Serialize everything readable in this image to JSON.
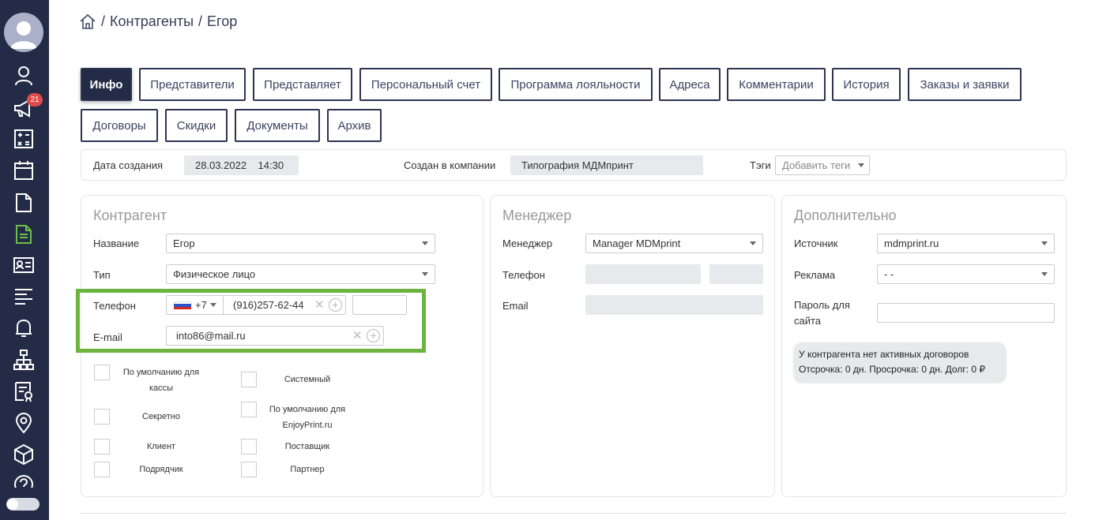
{
  "sidebar": {
    "badge_count": "21",
    "icons": [
      "user-icon",
      "megaphone-icon",
      "calculator-icon",
      "calendar-icon",
      "document-icon",
      "active-document-icon",
      "id-card-icon",
      "list-icon",
      "bell-icon",
      "sitemap-icon",
      "certificate-icon",
      "location-icon",
      "cube-icon",
      "help-icon"
    ]
  },
  "breadcrumb": {
    "sep1": "/",
    "item1": "Контрагенты",
    "sep2": "/",
    "item2": "Егор"
  },
  "tabs": [
    "Инфо",
    "Представители",
    "Представляет",
    "Персональный счет",
    "Программа лояльности",
    "Адреса",
    "Комментарии",
    "История",
    "Заказы и заявки",
    "Договоры",
    "Скидки",
    "Документы",
    "Архив"
  ],
  "info": {
    "created_label": "Дата создания",
    "created_value": "28.03.2022    14:30",
    "company_label": "Создан в компании",
    "company_value": "Типография МДМпринт",
    "tags_label": "Тэги",
    "tags_placeholder": "Добавить теги"
  },
  "contragent": {
    "title": "Контрагент",
    "name_label": "Название",
    "name_value": "Егор",
    "type_label": "Тип",
    "type_value": "Физическое лицо",
    "phone_label": "Телефон",
    "phone_code": "+7",
    "phone_value": "(916)257-62-44",
    "email_label": "E-mail",
    "email_value": "into86@mail.ru",
    "clear_symbol": "✕",
    "add_symbol": "+",
    "checkboxes": {
      "default_cash_line1": "По умолчанию для",
      "default_cash_line2": "кассы",
      "system": "Системный",
      "secret": "Секретно",
      "default_enjoy_line1": "По умолчанию для",
      "default_enjoy_line2": "EnjoyPrint.ru",
      "client": "Клиент",
      "supplier": "Поставщик",
      "contractor": "Подрядчик",
      "partner": "Партнер"
    }
  },
  "manager": {
    "title": "Менеджер",
    "manager_label": "Менеджер",
    "manager_value": "Manager MDMprint",
    "phone_label": "Телефон",
    "email_label": "Email"
  },
  "additional": {
    "title": "Дополнительно",
    "source_label": "Источник",
    "source_value": "mdmprint.ru",
    "ads_label": "Реклама",
    "ads_value": "- -",
    "password_label_line1": "Пароль для",
    "password_label_line2": "сайта",
    "notice_line1": "У контрагента нет активных договоров",
    "notice_line2": "Отсрочка: 0 дн. Просрочка: 0 дн. Долг: 0 ₽"
  }
}
